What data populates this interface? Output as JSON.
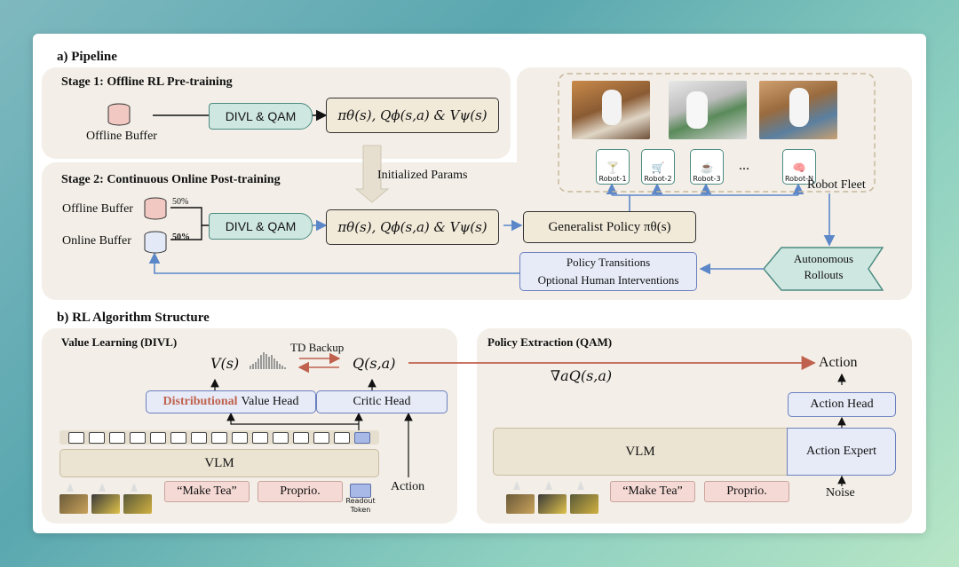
{
  "pipeline": {
    "title": "a) Pipeline",
    "stage1": {
      "title": "Stage 1: Offline RL Pre-training",
      "buffer": "Offline Buffer",
      "divl": "DIVL & QAM",
      "params": "πθ(s), Qϕ(s,a) & Vψ(s)"
    },
    "init_params": "Initialized Params",
    "stage2": {
      "title": "Stage 2: Continuous Online Post-training",
      "offline_buffer": "Offline Buffer",
      "online_buffer": "Online Buffer",
      "offline_pct": "50%",
      "online_pct": "50%",
      "divl": "DIVL & QAM",
      "params": "πθ(s), Qϕ(s,a) & Vψ(s)",
      "policy": "Generalist Policy πθ(s)",
      "transitions_line1": "Policy Transitions",
      "transitions_line2": "Optional Human Interventions",
      "rollouts_line1": "Autonomous",
      "rollouts_line2": "Rollouts"
    },
    "fleet": {
      "label": "Robot Fleet",
      "robots": [
        "Robot-1",
        "Robot-2",
        "Robot-3",
        "Robot-N"
      ],
      "ellipsis": "..."
    }
  },
  "rl": {
    "title": "b) RL Algorithm Structure",
    "value": {
      "title": "Value Learning (DIVL)",
      "v": "V(s)",
      "q": "Q(s,a)",
      "td": "TD Backup",
      "dist_word": "Distributional",
      "value_head": "Value Head",
      "critic_head": "Critic Head",
      "vlm": "VLM",
      "prompt": "“Make Tea”",
      "proprio": "Proprio.",
      "action": "Action",
      "readout1": "Readout",
      "readout2": "Token"
    },
    "policy": {
      "title": "Policy Extraction (QAM)",
      "grad": "∇aQ(s,a)",
      "action": "Action",
      "action_head": "Action Head",
      "vlm": "VLM",
      "action_expert": "Action Expert",
      "noise": "Noise",
      "prompt": "“Make Tea”",
      "proprio": "Proprio."
    }
  },
  "colors": {
    "teal": "#4c8c82",
    "arrow_blue": "#5b87c9",
    "accent_red": "#c0614e"
  }
}
